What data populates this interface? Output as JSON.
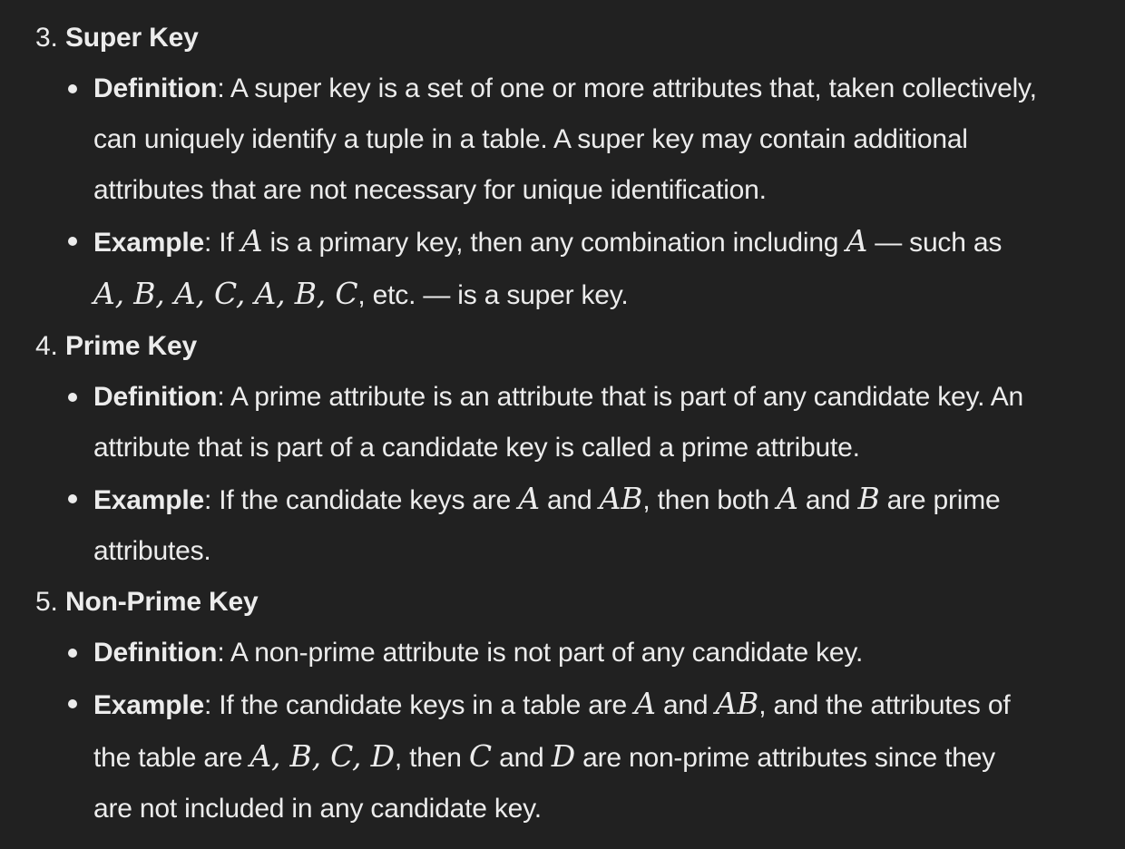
{
  "items": [
    {
      "number": "3.",
      "title": "Super Key",
      "definition_label": "Definition",
      "definition_lines": [
        ": A super key is a set of one or more attributes that, taken collectively,",
        "can uniquely identify a tuple in a table. A super key may contain additional",
        "attributes that are not necessary for unique identification."
      ],
      "example_label": "Example",
      "example": {
        "p1": ": If ",
        "m1": "A",
        "p2": " is a primary key, then any combination including ",
        "m2": "A",
        "p3": " — such as",
        "m3": "A, B, A, C, A, B, C",
        "p4": ", etc. — is a super key."
      }
    },
    {
      "number": "4.",
      "title": "Prime Key",
      "definition_label": "Definition",
      "definition_lines": [
        ": A prime attribute is an attribute that is part of any candidate key. An",
        "attribute that is part of a candidate key is called a prime attribute."
      ],
      "example_label": "Example",
      "example": {
        "p1": ": If the candidate keys are ",
        "m1": "A",
        "p2": " and ",
        "m2": "AB",
        "p3": ", then both ",
        "m3": "A",
        "p4": " and ",
        "m4": "B",
        "p5": " are prime",
        "p6": "attributes."
      }
    },
    {
      "number": "5.",
      "title": "Non-Prime Key",
      "definition_label": "Definition",
      "definition_lines": [
        ": A non-prime attribute is not part of any candidate key."
      ],
      "example_label": "Example",
      "example": {
        "p1": ": If the candidate keys in a table are ",
        "m1": "A",
        "p2": " and ",
        "m2": "AB",
        "p3": ", and the attributes of",
        "p4": "the table are ",
        "m3": "A, B, C, D",
        "p5": ", then ",
        "m4": "C",
        "p6": " and ",
        "m5": "D",
        "p7": " are non-prime attributes since they",
        "p8": "are not included in any candidate key."
      }
    }
  ]
}
